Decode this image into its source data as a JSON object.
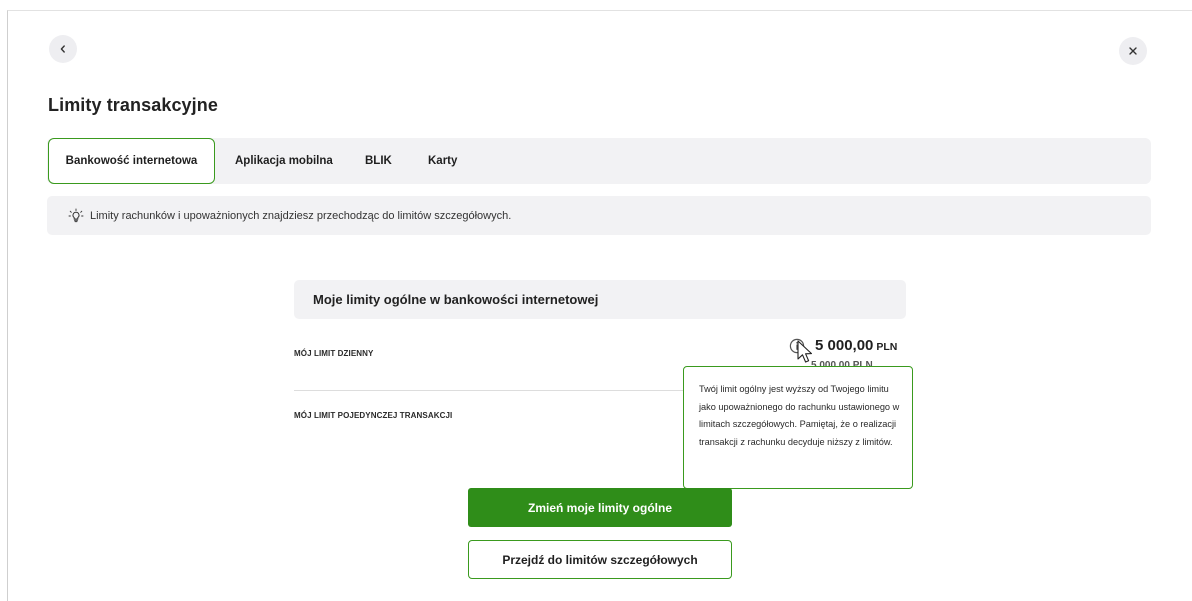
{
  "page": {
    "title": "Limity transakcyjne",
    "back_icon": "chevron-left-icon",
    "close_icon": "close-icon"
  },
  "tabs": [
    {
      "label": "Bankowość internetowa",
      "active": true
    },
    {
      "label": "Aplikacja mobilna",
      "active": false
    },
    {
      "label": "BLIK",
      "active": false
    },
    {
      "label": "Karty",
      "active": false
    }
  ],
  "info_bar": {
    "icon": "lightbulb-icon",
    "text": "Limity rachunków i upoważnionych znajdziesz przechodząc do limitów szczegółowych."
  },
  "limits_card": {
    "header": "Moje limity ogólne w bankowości internetowej",
    "daily": {
      "label": "MÓJ LIMIT DZIENNY",
      "amount": "5 000,00",
      "currency": "PLN",
      "sub_amount": "5 000,00 PLN"
    },
    "single": {
      "label": "MÓJ LIMIT POJEDYNCZEJ TRANSAKCJI"
    }
  },
  "tooltip": {
    "text": "Twój limit ogólny jest wyższy od Twojego limitu jako upoważnionego do rachunku ustawionego w limitach szczegółowych. Pamiętaj, że o realizacji transakcji z rachunku decyduje niższy z limitów."
  },
  "buttons": {
    "change_label": "Zmień moje limity ogólne",
    "details_label": "Przejdź do limitów szczegółowych"
  },
  "colors": {
    "accent": "#2f8d19",
    "border_accent": "#3a9a1e",
    "panel_bg": "#f2f2f4"
  }
}
